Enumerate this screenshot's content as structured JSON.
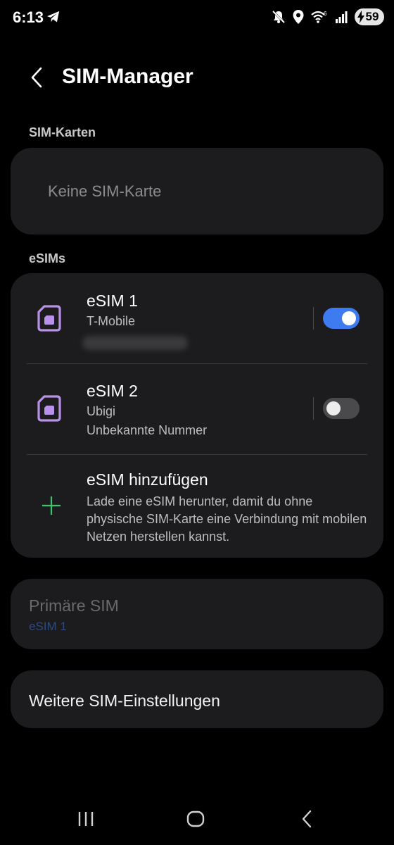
{
  "status_bar": {
    "time": "6:13",
    "battery_level": "59",
    "icons": [
      "telegram-icon",
      "mute-icon",
      "location-icon",
      "wifi-6-icon",
      "signal-icon",
      "battery-icon"
    ]
  },
  "header": {
    "title": "SIM-Manager",
    "back_icon": "chevron-left-icon"
  },
  "sim_cards": {
    "section_label": "SIM-Karten",
    "empty_text": "Keine SIM-Karte"
  },
  "esims": {
    "section_label": "eSIMs",
    "items": [
      {
        "name": "eSIM 1",
        "carrier": "T-Mobile",
        "number": "",
        "enabled": true
      },
      {
        "name": "eSIM 2",
        "carrier": "Ubigi",
        "number": "Unbekannte Nummer",
        "enabled": false
      }
    ],
    "add": {
      "title": "eSIM hinzufügen",
      "description": "Lade eine eSIM herunter, damit du ohne physische SIM-Karte eine Verbindung mit mobilen Netzen herstellen kannst.",
      "icon": "plus-icon",
      "accent_color": "#3ec46d"
    }
  },
  "primary_sim": {
    "title": "Primäre SIM",
    "value": "eSIM 1"
  },
  "more_settings": {
    "title": "Weitere SIM-Einstellungen"
  },
  "colors": {
    "background": "#000000",
    "card": "#1c1c1e",
    "toggle_on": "#3e7bf0",
    "sim_icon": "#b892e8"
  }
}
